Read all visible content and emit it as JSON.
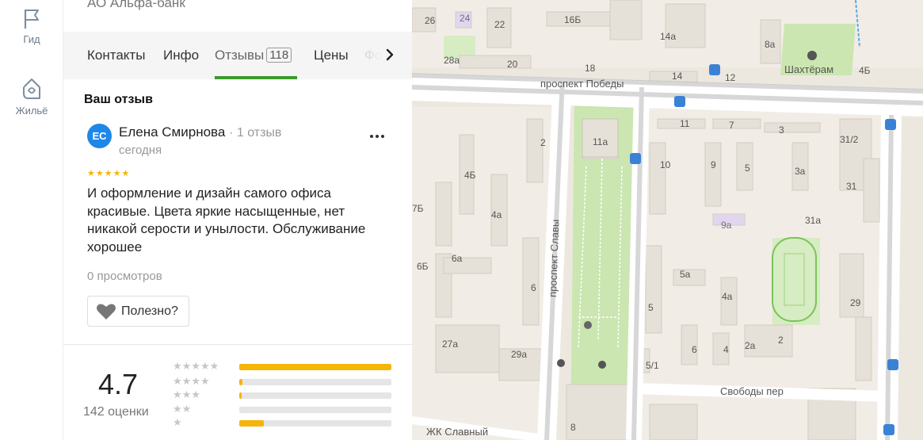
{
  "sidebar": {
    "items": [
      {
        "label": "Гид",
        "icon": "flag-icon"
      },
      {
        "label": "Жильё",
        "icon": "house-icon"
      }
    ]
  },
  "org": {
    "name": "АО Альфа-банк"
  },
  "tabs": [
    {
      "label": "Контакты"
    },
    {
      "label": "Инфо"
    },
    {
      "label": "Отзывы",
      "badge": "118",
      "active": true
    },
    {
      "label": "Цены"
    },
    {
      "label": "Фо"
    }
  ],
  "review": {
    "section_title": "Ваш отзыв",
    "avatar_initials": "ЕС",
    "author": "Елена Смирнова",
    "author_meta": "· 1 отзыв",
    "date": "сегодня",
    "stars": "★★★★★",
    "text": "И оформление и дизайн самого офиса красивые. Цвета яркие насыщенные, нет никакой серости и унылости. Обслуживание хорошее",
    "views": "0 просмотров",
    "helpful_label": "Полезно?"
  },
  "rating": {
    "value": "4.7",
    "count_label": "142 оценки",
    "distribution": [
      {
        "stars": "★★★★★",
        "fraction": 1.0
      },
      {
        "stars": "★★★★",
        "fraction": 0.02
      },
      {
        "stars": "★★★",
        "fraction": 0.015
      },
      {
        "stars": "★★",
        "fraction": 0.0
      },
      {
        "stars": "★",
        "fraction": 0.16
      }
    ]
  },
  "colors": {
    "accent_green": "#3b9b2b",
    "avatar_blue": "#1f87e8",
    "star_yellow": "#f5b50a"
  },
  "map": {
    "streets": [
      "проспект Победы",
      "проспект Славы",
      "Свободы пер"
    ],
    "places": [
      "Шахтёрам",
      "ЖК Славный"
    ],
    "house_numbers": [
      "26",
      "24",
      "22",
      "16Б",
      "14а",
      "8а",
      "28а",
      "20",
      "18",
      "14",
      "12",
      "4Б",
      "11",
      "7",
      "3",
      "11а",
      "2",
      "10",
      "9",
      "5",
      "3а",
      "4Б",
      "4а",
      "7Б",
      "6Б",
      "6а",
      "6",
      "8",
      "5а",
      "4а",
      "9а",
      "31/2",
      "31",
      "31а",
      "29",
      "5",
      "2а",
      "2",
      "27а",
      "29а",
      "5/1",
      "6",
      "4",
      "8"
    ]
  }
}
